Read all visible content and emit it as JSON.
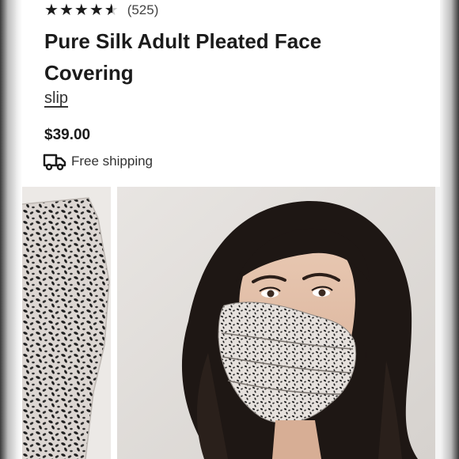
{
  "rating": {
    "stars": 4.5,
    "count": "(525)"
  },
  "product": {
    "title": "Pure Silk Adult Pleated Face Covering",
    "brand": "slip",
    "price": "$39.00"
  },
  "shipping": {
    "label": "Free shipping",
    "icon": "truck-icon"
  },
  "colors": {
    "text": "#1b1b1b",
    "star_empty": "#c9c9c9"
  }
}
